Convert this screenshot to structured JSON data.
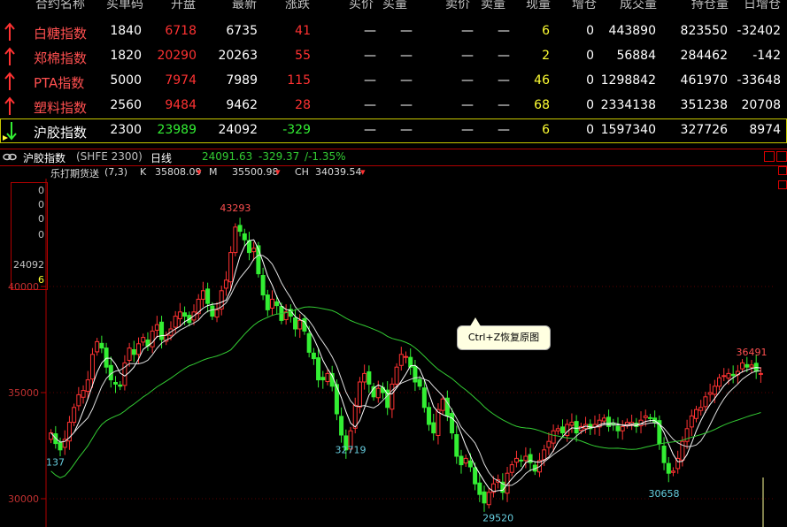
{
  "header": {
    "columns": [
      "合约名称",
      "买单码",
      "开盘",
      "最新",
      "涨跌",
      "买价",
      "买量",
      "卖价",
      "卖量",
      "现量",
      "增仓",
      "成交量",
      "持仓量",
      "日增仓"
    ]
  },
  "quotes": [
    {
      "name": "白糖指数",
      "buy_code": "1840",
      "open": "6718",
      "last": "6735",
      "change": "41",
      "bid": "—",
      "bid_vol": "—",
      "ask": "—",
      "ask_vol": "—",
      "cur_vol": "6",
      "inc": "0",
      "volume": "443890",
      "oi": "823550",
      "day_inc": "-32402",
      "dir": "up"
    },
    {
      "name": "郑棉指数",
      "buy_code": "1820",
      "open": "20290",
      "last": "20263",
      "change": "55",
      "bid": "—",
      "bid_vol": "—",
      "ask": "—",
      "ask_vol": "—",
      "cur_vol": "2",
      "inc": "0",
      "volume": "56884",
      "oi": "284462",
      "day_inc": "-142",
      "dir": "up"
    },
    {
      "name": "PTA指数",
      "buy_code": "5000",
      "open": "7974",
      "last": "7989",
      "change": "115",
      "bid": "—",
      "bid_vol": "—",
      "ask": "—",
      "ask_vol": "—",
      "cur_vol": "46",
      "inc": "0",
      "volume": "1298842",
      "oi": "461970",
      "day_inc": "-33648",
      "dir": "up"
    },
    {
      "name": "塑料指数",
      "buy_code": "2560",
      "open": "9484",
      "last": "9462",
      "change": "28",
      "bid": "—",
      "bid_vol": "—",
      "ask": "—",
      "ask_vol": "—",
      "cur_vol": "68",
      "inc": "0",
      "volume": "2334138",
      "oi": "351238",
      "day_inc": "20708",
      "dir": "up"
    },
    {
      "name": "沪胶指数",
      "buy_code": "2300",
      "open": "23989",
      "last": "24092",
      "change": "-329",
      "bid": "—",
      "bid_vol": "—",
      "ask": "—",
      "ask_vol": "—",
      "cur_vol": "6",
      "inc": "0",
      "volume": "1597340",
      "oi": "327726",
      "day_inc": "8974",
      "dir": "down"
    }
  ],
  "chart_panel": {
    "title": "沪胶指数",
    "code": "(SHFE 2300)",
    "period": "日线",
    "price": "24091.63",
    "change": "-329.37",
    "change_pct": "/-1.35%",
    "indicator_name": "乐打期货送",
    "indicator_params": "(7,3)",
    "k_label": "K",
    "k_value": "35808.09",
    "m_label": "M",
    "m_value": "35500.98",
    "ch_label": "CH",
    "ch_value": "34039.54",
    "side_values": [
      "0",
      "0",
      "0",
      "0"
    ],
    "side_price": "24092",
    "side_vol": "6",
    "tooltip": "Ctrl+Z恢复原图",
    "colors": {
      "up": "#ff3232",
      "down": "#33ee33",
      "k_line": "#ffffff",
      "ma_line": "#33cc33",
      "axis": "#b00000"
    }
  },
  "chart_data": {
    "type": "candlestick",
    "y_ticks": [
      30000,
      35000,
      40000
    ],
    "ylim": [
      29000,
      45000
    ],
    "annotations": [
      {
        "label": "43293",
        "value": 43293,
        "index": 40
      },
      {
        "label": "32719",
        "value": 32719,
        "index": 65
      },
      {
        "label": "29520",
        "value": 29520,
        "index": 97
      },
      {
        "label": "30658",
        "value": 30658,
        "index": 133
      },
      {
        "label": "36491",
        "value": 36491,
        "index": 152
      },
      {
        "label": "137",
        "value": 32137,
        "index": 1
      }
    ],
    "closes": [
      33100,
      32600,
      32300,
      32800,
      33600,
      34300,
      34900,
      35100,
      35600,
      36800,
      37400,
      37100,
      36200,
      35600,
      35400,
      35300,
      36400,
      37100,
      36800,
      37300,
      37600,
      37200,
      37900,
      38200,
      37500,
      37700,
      38000,
      38600,
      38800,
      38600,
      38300,
      38800,
      39400,
      39800,
      39200,
      38600,
      38900,
      39800,
      40300,
      41600,
      42800,
      42600,
      42200,
      41600,
      41800,
      40600,
      39600,
      38900,
      39400,
      39100,
      38400,
      38800,
      38600,
      38000,
      38400,
      37900,
      36900,
      36600,
      35600,
      35600,
      35900,
      35300,
      34000,
      33000,
      32300,
      33200,
      34400,
      35500,
      35900,
      35400,
      34800,
      35200,
      35000,
      34300,
      35400,
      36200,
      36800,
      36700,
      36200,
      35500,
      35300,
      34300,
      33500,
      33100,
      34200,
      34700,
      33900,
      33100,
      32000,
      31600,
      31900,
      31500,
      30700,
      30200,
      29800,
      30300,
      30700,
      30900,
      30300,
      31200,
      31600,
      31900,
      31800,
      32000,
      31700,
      31300,
      31800,
      32300,
      32700,
      33200,
      33300,
      33100,
      33500,
      33600,
      33100,
      33400,
      33500,
      33300,
      33500,
      33700,
      33800,
      33400,
      33500,
      33200,
      33400,
      33600,
      33600,
      33400,
      33700,
      33900,
      33800,
      33600,
      32600,
      31700,
      31200,
      31300,
      31900,
      32700,
      33300,
      33900,
      34200,
      34300,
      34800,
      35000,
      35300,
      35700,
      35800,
      35900,
      35800,
      36000,
      36400,
      36200,
      36300,
      36000,
      35900
    ]
  }
}
